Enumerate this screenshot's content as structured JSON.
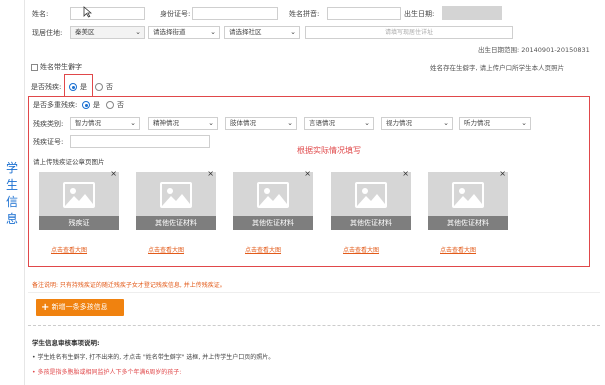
{
  "row1": {
    "name_label": "姓名:",
    "id_label": "身份证号:",
    "pinyin_label": "姓名拼音:",
    "birth_label": "出生日期:"
  },
  "row2": {
    "area_label": "现居住地:",
    "district_value": "秦美区",
    "street_placeholder": "请选择街道",
    "community_placeholder": "请选择社区",
    "detail_placeholder": "请填写现居住详址"
  },
  "birth_range": "出生日期范围: 20140901-20150831",
  "rare_char": {
    "label": "姓名带生僻字",
    "hint": "姓名存在生僻字, 请上传户口所学生本人页照片"
  },
  "disabled_q": {
    "label": "是否残疾:",
    "yes": "是",
    "no": "否"
  },
  "multi_q": {
    "label": "是否多重残疾:",
    "yes": "是",
    "no": "否"
  },
  "types": {
    "label": "残疾类别:",
    "options": [
      "智力情况",
      "精神情况",
      "肢体情况",
      "言语情况",
      "视力情况",
      "听力情况"
    ]
  },
  "cert_label": "残疾证号:",
  "fill_hint": "根据实际情况填写",
  "upload_title": "请上传残疾证公章页图片",
  "cards": [
    {
      "caption": "残疾证",
      "link": "点击查看大图"
    },
    {
      "caption": "其他佐证材料",
      "link": "点击查看大图"
    },
    {
      "caption": "其他佐证材料",
      "link": "点击查看大图"
    },
    {
      "caption": "其他佐证材料",
      "link": "点击查看大图"
    },
    {
      "caption": "其他佐证材料",
      "link": "点击查看大图"
    }
  ],
  "remark": "备注说明: 只有持残疾证的随迁残疾子女才登记残疾信息, 并上传残疾证。",
  "add_button": "新增一条多孩信息",
  "side_title": [
    "学",
    "生",
    "信",
    "息"
  ],
  "review": {
    "title": "学生信息审核事项说明:",
    "line1": "• 学生姓名有生僻字, 打不出来的, 才点击 \"姓名带生僻字\" 选框, 并上传学生户口页的照片。",
    "line2": "• 多孩是指多胞胎或相同监护人下多个年满6周岁的孩子:"
  },
  "colors": {
    "accent_blue": "#1a6fd1",
    "red_border": "#e0484a",
    "orange": "#f0820f",
    "link_orange": "#e35b1a"
  }
}
